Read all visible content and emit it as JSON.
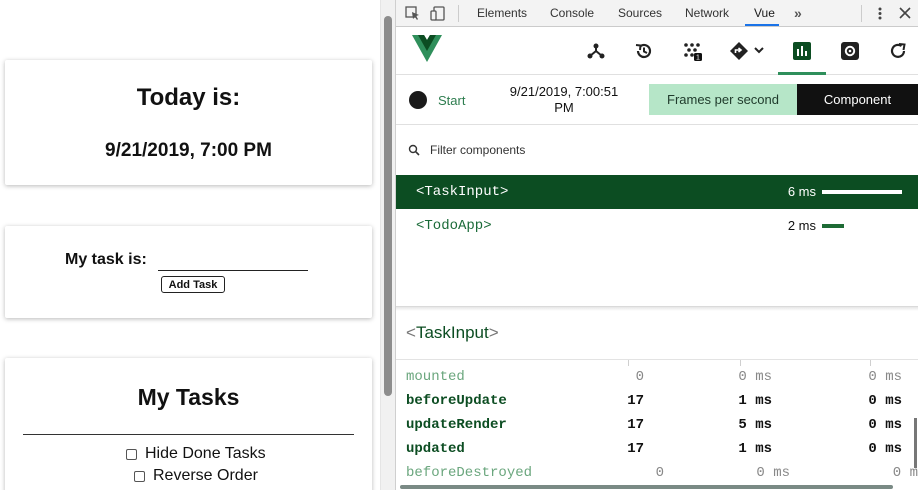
{
  "app": {
    "today_title": "Today is:",
    "today_date": "9/21/2019, 7:00 PM",
    "task_label": "My task is:",
    "task_input_value": "",
    "add_task_label": "Add Task",
    "tasks_title": "My Tasks",
    "hide_done_label": "Hide Done Tasks",
    "reverse_order_label": "Reverse Order",
    "hide_done_checked": false,
    "reverse_order_checked": false
  },
  "devtools": {
    "tabs": [
      {
        "label": "Elements"
      },
      {
        "label": "Console"
      },
      {
        "label": "Sources"
      },
      {
        "label": "Network"
      },
      {
        "label": "Vue"
      }
    ],
    "active_tab": "Vue",
    "more_tabs_label": "»",
    "vue": {
      "toolbar_icons": [
        "components-icon",
        "history-icon",
        "vuex-icon",
        "routing-icon",
        "performance-icon",
        "settings-icon",
        "refresh-icon"
      ],
      "vuex_badge": "1",
      "performance": {
        "start_label": "Start",
        "recorded_date": "9/21/2019, 7:00:51 PM",
        "fps_tab_label": "Frames per second",
        "component_tab_label": "Component",
        "active_subtab": "Component"
      },
      "filter": {
        "placeholder": "Filter components"
      },
      "components": [
        {
          "name": "<TaskInput>",
          "time": "6 ms",
          "relative": 1.0,
          "selected": true
        },
        {
          "name": "<TodoApp>",
          "time": "2 ms",
          "relative": 0.27,
          "selected": false
        }
      ],
      "detail": {
        "open_bracket": "<",
        "name": "TaskInput",
        "close_bracket": ">",
        "hooks": [
          {
            "name": "mounted",
            "count": "0",
            "total": "0 ms",
            "avg": "0 ms",
            "style": "dim"
          },
          {
            "name": "beforeUpdate",
            "count": "17",
            "total": "1 ms",
            "avg": "0 ms",
            "style": "strong"
          },
          {
            "name": "updateRender",
            "count": "17",
            "total": "5 ms",
            "avg": "0 ms",
            "style": "strong"
          },
          {
            "name": "updated",
            "count": "17",
            "total": "1 ms",
            "avg": "0 ms",
            "style": "strong"
          },
          {
            "name": "beforeDestroyed",
            "count": "0",
            "total": "0 ms",
            "avg": "0 m",
            "style": "dim"
          }
        ]
      }
    }
  },
  "colors": {
    "vue_green_dark": "#0c4d22",
    "vue_green": "#2e7d4f",
    "fps_tab_bg": "#b6e6c8",
    "devtools_active_tab": "#1a73e8"
  }
}
